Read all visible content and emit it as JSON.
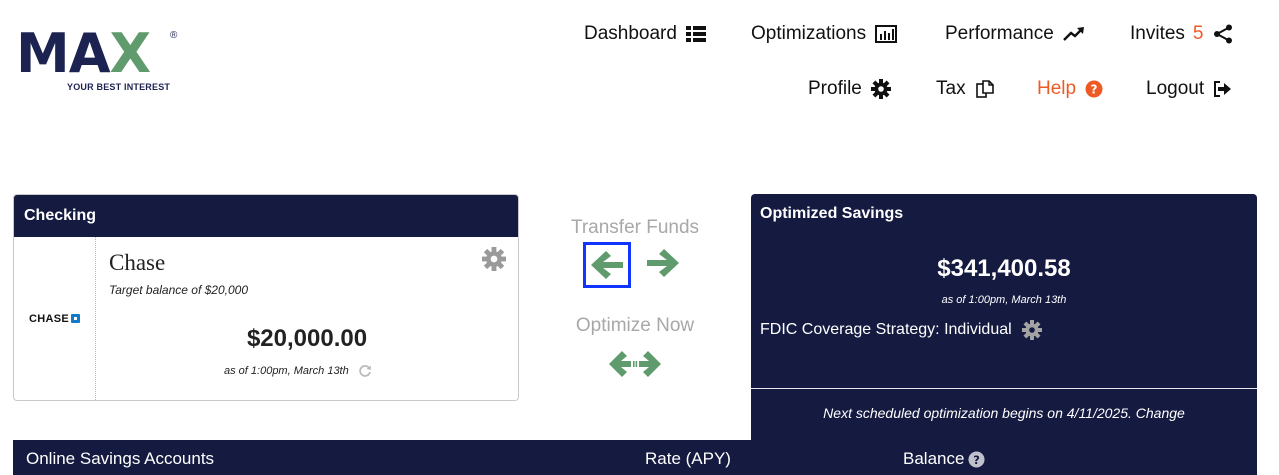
{
  "logo": {
    "word_left": "MA",
    "word_x": "X",
    "registered": "®",
    "tagline": "YOUR BEST INTEREST"
  },
  "nav": {
    "dashboard": "Dashboard",
    "optimizations": "Optimizations",
    "performance": "Performance",
    "invites": "Invites",
    "invites_count": "5",
    "profile": "Profile",
    "tax": "Tax",
    "help": "Help",
    "logout": "Logout"
  },
  "checking": {
    "title": "Checking",
    "bank_logo_text": "CHASE",
    "bank_name": "Chase",
    "target": "Target balance of $20,000",
    "balance": "$20,000.00",
    "as_of": "as of 1:00pm, March 13th"
  },
  "transfer": {
    "title": "Transfer Funds"
  },
  "optimize": {
    "title": "Optimize Now"
  },
  "savings": {
    "title": "Optimized Savings",
    "balance": "$341,400.58",
    "as_of": "as of 1:00pm, March 13th",
    "fdic": "FDIC Coverage Strategy: Individual",
    "next": "Next scheduled optimization begins on 4/11/2025. Change"
  },
  "table": {
    "col_accounts": "Online Savings Accounts",
    "col_rate": "Rate (APY)",
    "col_balance": "Balance"
  },
  "colors": {
    "navy": "#151a40",
    "green": "#5f9b6c",
    "accent_orange": "#ee5a24",
    "highlight": "#1234ff"
  }
}
